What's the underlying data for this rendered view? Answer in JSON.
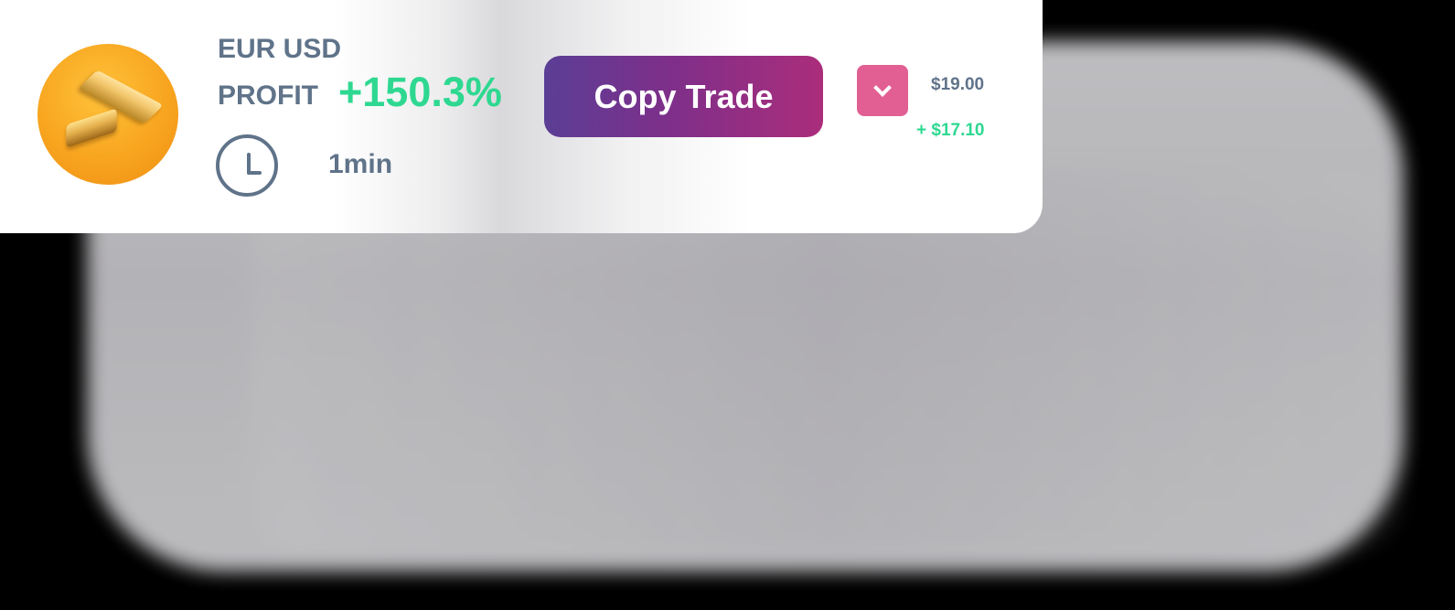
{
  "trade_card": {
    "asset_icon": "gold-bars-icon",
    "pair": "EUR USD",
    "profit_label": "PROFIT",
    "profit_value": "+150.3%",
    "duration_icon": "clock-icon",
    "duration": "1min",
    "copy_button_label": "Copy Trade",
    "dropdown_icon": "chevron-down-icon",
    "amount": "$19.00",
    "gain": "+ $17.10"
  },
  "colors": {
    "accent_green": "#2ed890",
    "text_slate": "#5f7389",
    "button_gradient_start": "#5b3e95",
    "button_gradient_end": "#ab2d7b",
    "dropdown_pink": "#e15f93",
    "gold_circle": "#f8a51f"
  }
}
